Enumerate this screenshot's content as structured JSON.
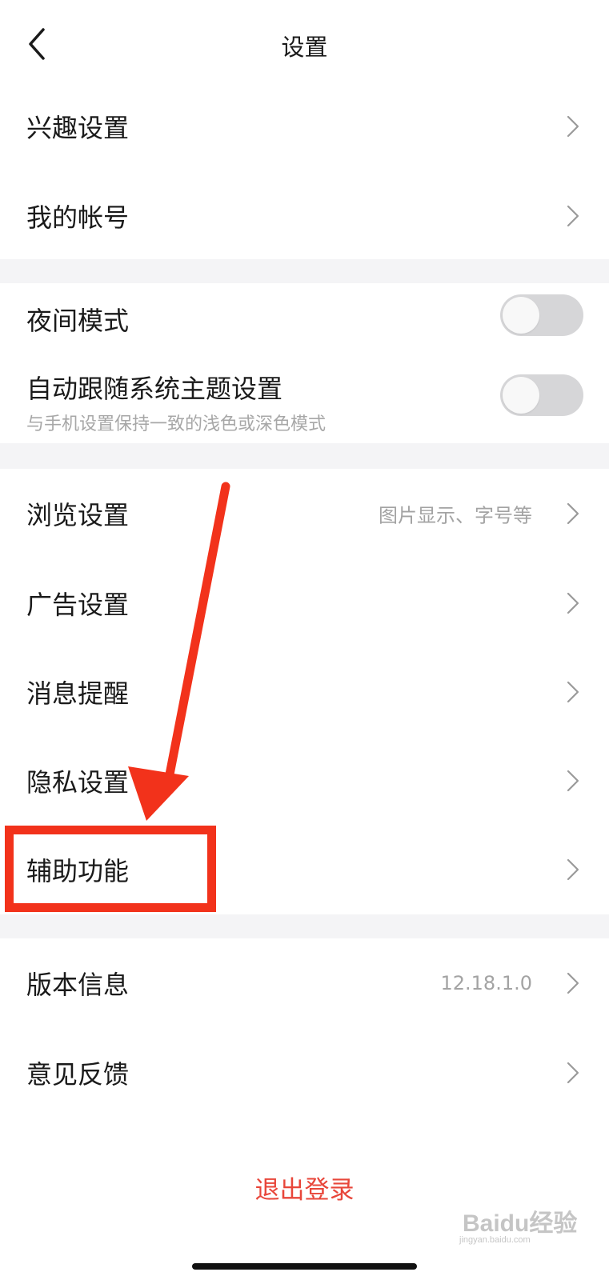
{
  "header": {
    "title": "设置"
  },
  "section1": [
    {
      "label": "兴趣设置"
    },
    {
      "label": "我的帐号"
    }
  ],
  "section2": {
    "night_mode": {
      "label": "夜间模式",
      "on": false
    },
    "follow_system": {
      "label": "自动跟随系统主题设置",
      "sublabel": "与手机设置保持一致的浅色或深色模式",
      "on": false
    }
  },
  "section3": [
    {
      "label": "浏览设置",
      "value": "图片显示、字号等"
    },
    {
      "label": "广告设置"
    },
    {
      "label": "消息提醒"
    },
    {
      "label": "隐私设置"
    },
    {
      "label": "辅助功能"
    }
  ],
  "section4": [
    {
      "label": "版本信息",
      "value": "12.18.1.0"
    },
    {
      "label": "意见反馈"
    }
  ],
  "logout": {
    "label": "退出登录"
  },
  "watermark": {
    "text": "Baidu经验",
    "subtext": "jingyan.baidu.com"
  },
  "colors": {
    "logout": "#e8463a",
    "annotation": "#f2321b",
    "section_gap": "#f4f4f6"
  }
}
